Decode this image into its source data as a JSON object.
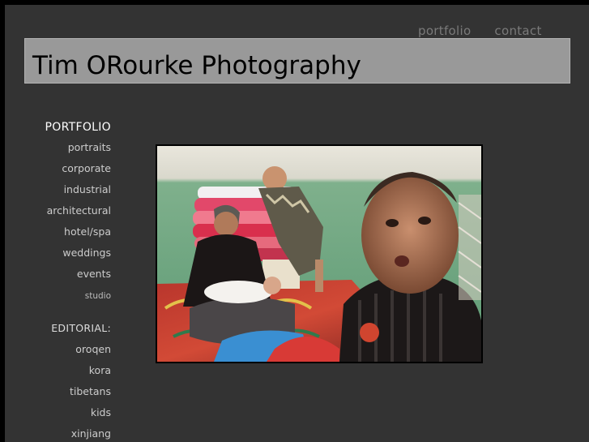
{
  "header": {
    "title": "Tim ORourke Photography",
    "nav": [
      "portfolio",
      "contact"
    ]
  },
  "sidebar": {
    "portfolio_heading": "PORTFOLIO",
    "portfolio_items": [
      "portraits",
      "corporate",
      "industrial",
      "architectural",
      "hotel/spa",
      "weddings",
      "events",
      "studio"
    ],
    "editorial_heading": "EDITORIAL:",
    "editorial_items": [
      "oroqen",
      "kora",
      "tibetans",
      "kids",
      "xinjiang"
    ]
  },
  "colors": {
    "page_background": "#333333",
    "banner_background": "#999999",
    "nav_text": "#7a7a7a",
    "menu_text": "#cccccc"
  }
}
